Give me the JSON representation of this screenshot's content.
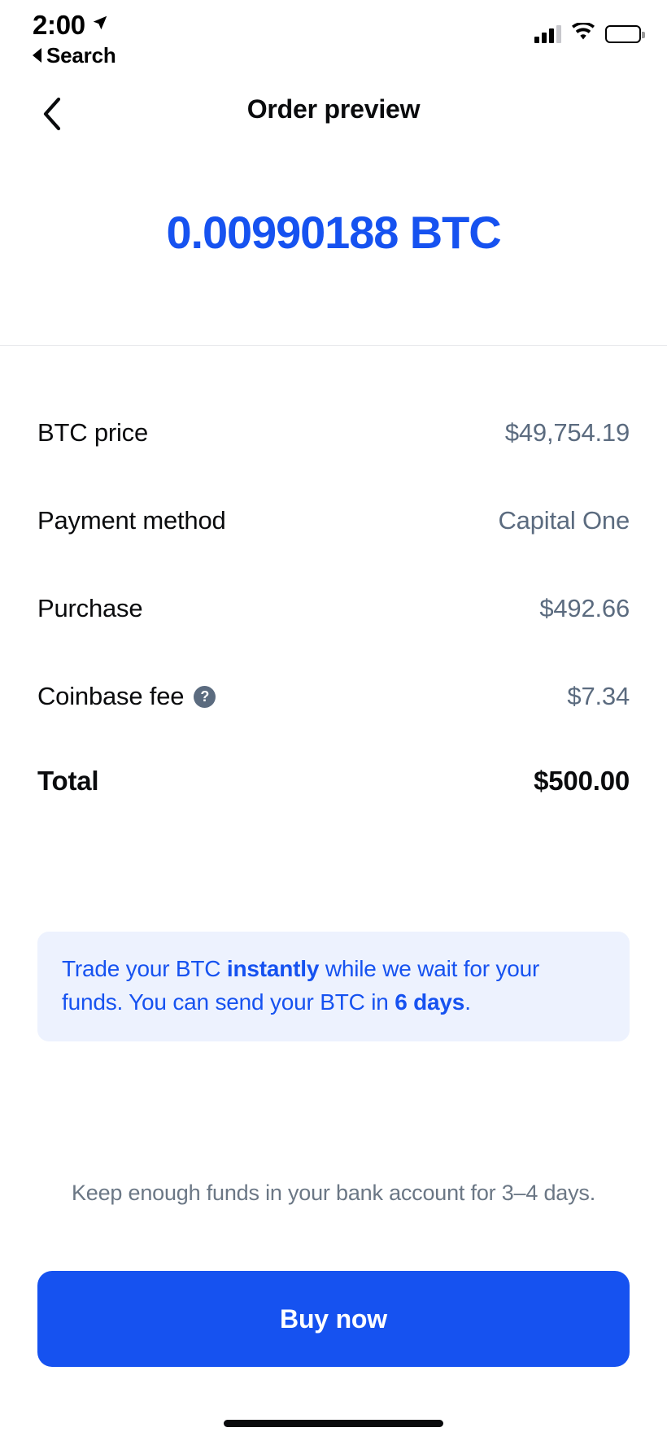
{
  "status_bar": {
    "time": "2:00",
    "location_icon": "location-arrow-icon",
    "back_to_app_label": "Search",
    "signal_icon": "cellular-signal-icon",
    "wifi_icon": "wifi-icon",
    "battery_icon": "battery-icon"
  },
  "nav": {
    "back_icon": "chevron-left-icon",
    "title": "Order preview"
  },
  "hero": {
    "amount": "0.00990188 BTC",
    "accent_color": "#1652F0"
  },
  "details": {
    "rows": [
      {
        "label": "BTC price",
        "value": "$49,754.19"
      },
      {
        "label": "Payment method",
        "value": "Capital One"
      },
      {
        "label": "Purchase",
        "value": "$492.66"
      },
      {
        "label": "Coinbase fee",
        "value": "$7.34",
        "help_icon": "question-mark-icon"
      }
    ],
    "total": {
      "label": "Total",
      "value": "$500.00"
    },
    "value_color": "#5B6B7F",
    "label_color": "#0A0B0D"
  },
  "banner": {
    "part1": "Trade your BTC ",
    "bold1": "instantly",
    "part2": " while we wait for your funds. You can send your BTC in ",
    "bold2": "6 days",
    "part3": ".",
    "background_color": "#EDF2FE",
    "text_color": "#1652F0"
  },
  "footnote": {
    "text": "Keep enough funds in your bank account for 3–4 days."
  },
  "cta": {
    "label": "Buy now",
    "background_color": "#1652F0",
    "text_color": "#FFFFFF"
  }
}
